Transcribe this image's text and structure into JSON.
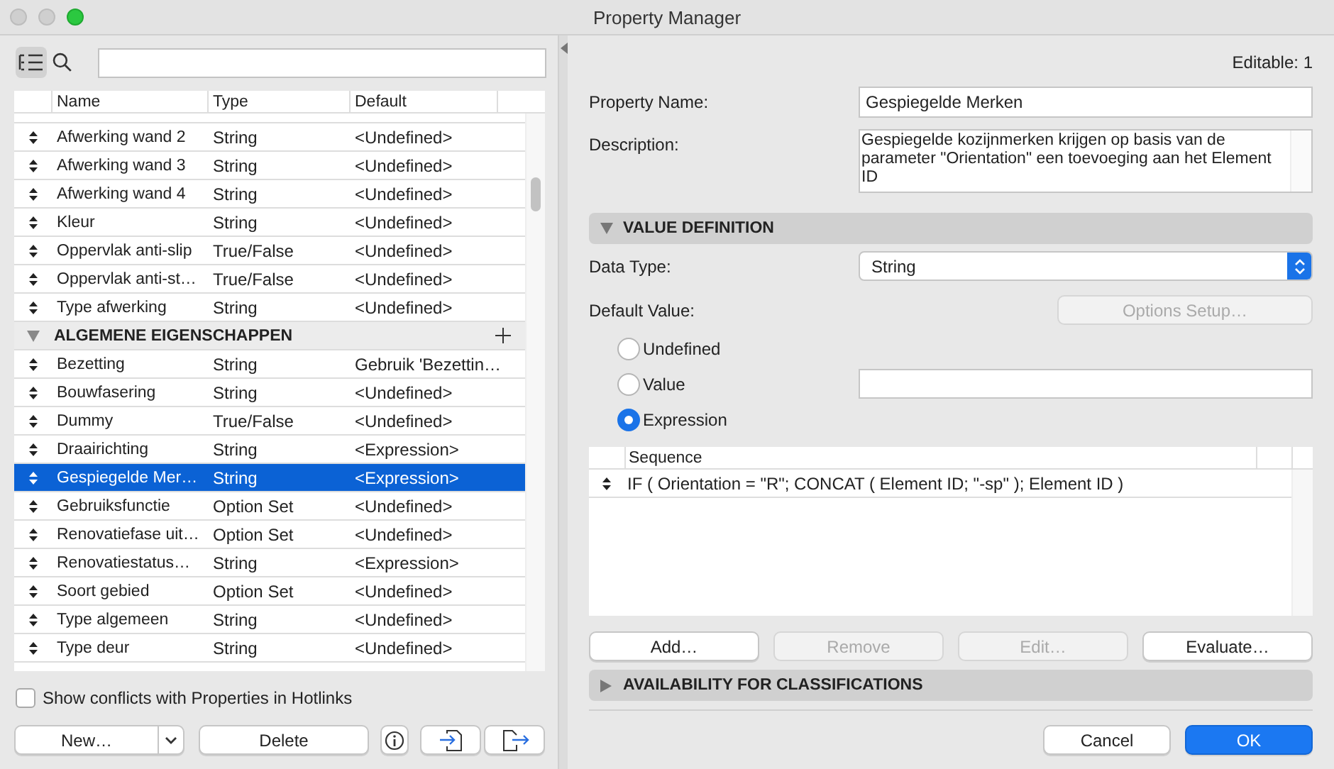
{
  "window": {
    "title": "Property Manager"
  },
  "table": {
    "columns": [
      "Name",
      "Type",
      "Default"
    ],
    "rows": [
      {
        "kind": "row",
        "name": "Afwerking wand 2",
        "type": "String",
        "default": "<Undefined>",
        "selected": false
      },
      {
        "kind": "row",
        "name": "Afwerking wand 3",
        "type": "String",
        "default": "<Undefined>",
        "selected": false
      },
      {
        "kind": "row",
        "name": "Afwerking wand 4",
        "type": "String",
        "default": "<Undefined>",
        "selected": false
      },
      {
        "kind": "row",
        "name": "Kleur",
        "type": "String",
        "default": "<Undefined>",
        "selected": false
      },
      {
        "kind": "row",
        "name": "Oppervlak anti-slip",
        "type": "True/False",
        "default": "<Undefined>",
        "selected": false
      },
      {
        "kind": "row",
        "name": "Oppervlak anti-st…",
        "type": "True/False",
        "default": "<Undefined>",
        "selected": false
      },
      {
        "kind": "row",
        "name": "Type afwerking",
        "type": "String",
        "default": "<Undefined>",
        "selected": false
      },
      {
        "kind": "group",
        "name": "ALGEMENE EIGENSCHAPPEN",
        "expanded": true
      },
      {
        "kind": "row",
        "name": "Bezetting",
        "type": "String",
        "default": "Gebruik 'Bezettin…",
        "selected": false
      },
      {
        "kind": "row",
        "name": "Bouwfasering",
        "type": "String",
        "default": "<Undefined>",
        "selected": false
      },
      {
        "kind": "row",
        "name": "Dummy",
        "type": "True/False",
        "default": "<Undefined>",
        "selected": false
      },
      {
        "kind": "row",
        "name": "Draairichting",
        "type": "String",
        "default": "<Expression>",
        "selected": false
      },
      {
        "kind": "row",
        "name": "Gespiegelde Mer…",
        "type": "String",
        "default": "<Expression>",
        "selected": true
      },
      {
        "kind": "row",
        "name": "Gebruiksfunctie",
        "type": "Option Set",
        "default": "<Undefined>",
        "selected": false
      },
      {
        "kind": "row",
        "name": "Renovatiefase uit…",
        "type": "Option Set",
        "default": "<Undefined>",
        "selected": false
      },
      {
        "kind": "row",
        "name": "Renovatiestatus…",
        "type": "String",
        "default": "<Expression>",
        "selected": false
      },
      {
        "kind": "row",
        "name": "Soort gebied",
        "type": "Option Set",
        "default": "<Undefined>",
        "selected": false
      },
      {
        "kind": "row",
        "name": "Type algemeen",
        "type": "String",
        "default": "<Undefined>",
        "selected": false
      },
      {
        "kind": "row",
        "name": "Type deur",
        "type": "String",
        "default": "<Undefined>",
        "selected": false
      }
    ]
  },
  "show_conflicts": {
    "label": "Show conflicts with Properties in Hotlinks",
    "checked": false
  },
  "left_buttons": [
    {
      "kind": "split",
      "label": "New…"
    },
    {
      "kind": "plain",
      "label": "Delete"
    },
    {
      "kind": "info"
    },
    {
      "kind": "import"
    },
    {
      "kind": "export"
    }
  ],
  "editable": "Editable: 1",
  "property_name": {
    "label": "Property Name:",
    "value": "Gespiegelde Merken"
  },
  "description": {
    "label": "Description:",
    "value": "Gespiegelde kozijnmerken krijgen op basis van de parameter \"Orientation\" een toevoeging aan het Element ID"
  },
  "value_definition": {
    "title": "VALUE DEFINITION",
    "expanded": true,
    "data_type": {
      "label": "Data Type:",
      "value": "String"
    },
    "default_value": {
      "label": "Default Value:",
      "options_button": {
        "label": "Options Setup…",
        "disabled": true
      },
      "options": [
        {
          "kind": "plain",
          "label": "Undefined",
          "selected": false
        },
        {
          "kind": "field",
          "label": "Value",
          "selected": false
        },
        {
          "kind": "plain",
          "label": "Expression",
          "selected": true
        }
      ]
    },
    "sequence": {
      "column": "Sequence",
      "rows": [
        "IF ( Orientation = \"R\"; CONCAT ( Element ID; \"-sp\" ); Element ID )"
      ]
    },
    "buttons": [
      {
        "label": "Add…",
        "disabled": false
      },
      {
        "label": "Remove",
        "disabled": true
      },
      {
        "label": "Edit…",
        "disabled": true
      },
      {
        "label": "Evaluate…",
        "disabled": false
      }
    ]
  },
  "availability": {
    "title": "AVAILABILITY FOR CLASSIFICATIONS",
    "expanded": false
  },
  "dialog_buttons": [
    {
      "kind": "default",
      "label": "Cancel"
    },
    {
      "kind": "primary",
      "label": "OK"
    }
  ]
}
